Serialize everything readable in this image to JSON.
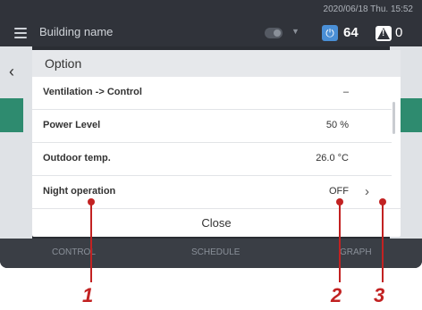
{
  "header": {
    "building_name": "Building name",
    "datetime": "2020/06/18 Thu. 15:52",
    "power_count": "64",
    "warning_count": "0",
    "power_icon": "power-icon",
    "warning_icon": "warning-icon"
  },
  "bottom_tabs": [
    "CONTROL",
    "SCHEDULE",
    "GRAPH"
  ],
  "modal": {
    "title": "Option",
    "rows": [
      {
        "label": "Ventilation -> Control",
        "value": "–"
      },
      {
        "label": "Power Level",
        "value": "50 %"
      },
      {
        "label": "Outdoor temp.",
        "value": "26.0 °C"
      },
      {
        "label": "Night operation",
        "value": "OFF"
      }
    ],
    "close_label": "Close"
  },
  "callouts": [
    "1",
    "2",
    "3"
  ],
  "colors": {
    "accent_red": "#c22222",
    "green": "#2e8b6f",
    "power_blue": "#4a8fd6"
  }
}
